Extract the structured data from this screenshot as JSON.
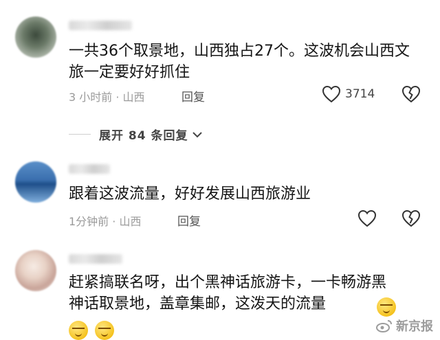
{
  "comments": [
    {
      "text": "一共36个取景地，山西独占27个。这波机会山西文旅一定要好好抓住",
      "meta": "3 小时前 · 山西",
      "reply_label": "回复",
      "likes": "3714"
    },
    {
      "text": "跟着这波流量，好好发展山西旅游业",
      "meta": "1分钟前 · 山西",
      "reply_label": "回复",
      "likes": ""
    },
    {
      "text": "赶紧搞联名呀，出个黑神话旅游卡，一卡畅游黑神话取景地，盖章集邮，这泼天的流量",
      "meta": "",
      "reply_label": "",
      "likes": ""
    }
  ],
  "expand_replies": "展开 84 条回复",
  "watermark": "新京报",
  "icons": {
    "like": "heart-outline-icon",
    "dislike": "broken-heart-icon",
    "expand": "chevron-down-icon",
    "emoji": "smug-face-emoji"
  },
  "colors": {
    "text": "#151515",
    "meta": "#9a9a9a",
    "icon": "#333333"
  }
}
